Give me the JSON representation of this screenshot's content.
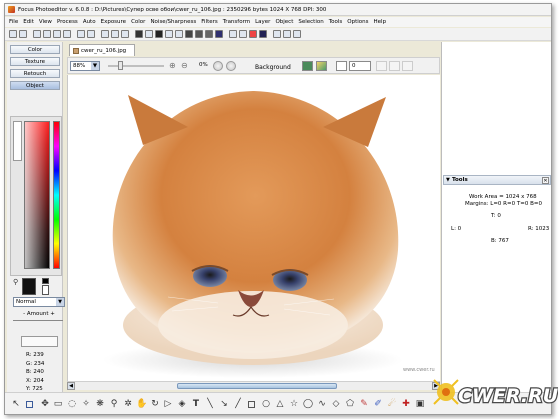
{
  "window": {
    "title": "Focus Photoeditor v. 6.0.8 :  D:\\Pictures\\Супер осве обои\\cwer_ru_106.jpg : 2350296 bytes   1024 X 768 DPI: 300"
  },
  "menubar": {
    "items": [
      "File",
      "Edit",
      "View",
      "Process",
      "Auto",
      "Exposure",
      "Color",
      "Noise/Sharpness",
      "Filters",
      "Transform",
      "Layer",
      "Object",
      "Selection",
      "Tools",
      "Options",
      "Help"
    ]
  },
  "left_panel": {
    "tabs": [
      "Color",
      "Texture",
      "Retouch",
      "Object"
    ],
    "active_tab": "Object",
    "blend_mode": "Normal",
    "amount_label": "- Amount +",
    "readout": {
      "r": "R: 239",
      "g": "G: 234",
      "b": "B: 240",
      "x": "X: 204",
      "y": "Y: 725"
    }
  },
  "document": {
    "tab_label": "cwer_ru_106.jpg",
    "zoom": "88%",
    "percent": "0%",
    "background_label": "Background",
    "layer_value": "0",
    "watermark": "www.cwer.ru"
  },
  "tools_panel": {
    "title": "Tools",
    "work_area": "Work Area = 1024 x 768",
    "margins": "Margins: L=0 R=0 T=0 B=0",
    "t": "T: 0",
    "l": "L: 0",
    "r": "R: 1023",
    "b": "B: 767"
  },
  "logo": {
    "text": "CWER.RU"
  },
  "colors": {
    "accent": "#a9bfdf",
    "kitten_fur": "#d9844a"
  }
}
